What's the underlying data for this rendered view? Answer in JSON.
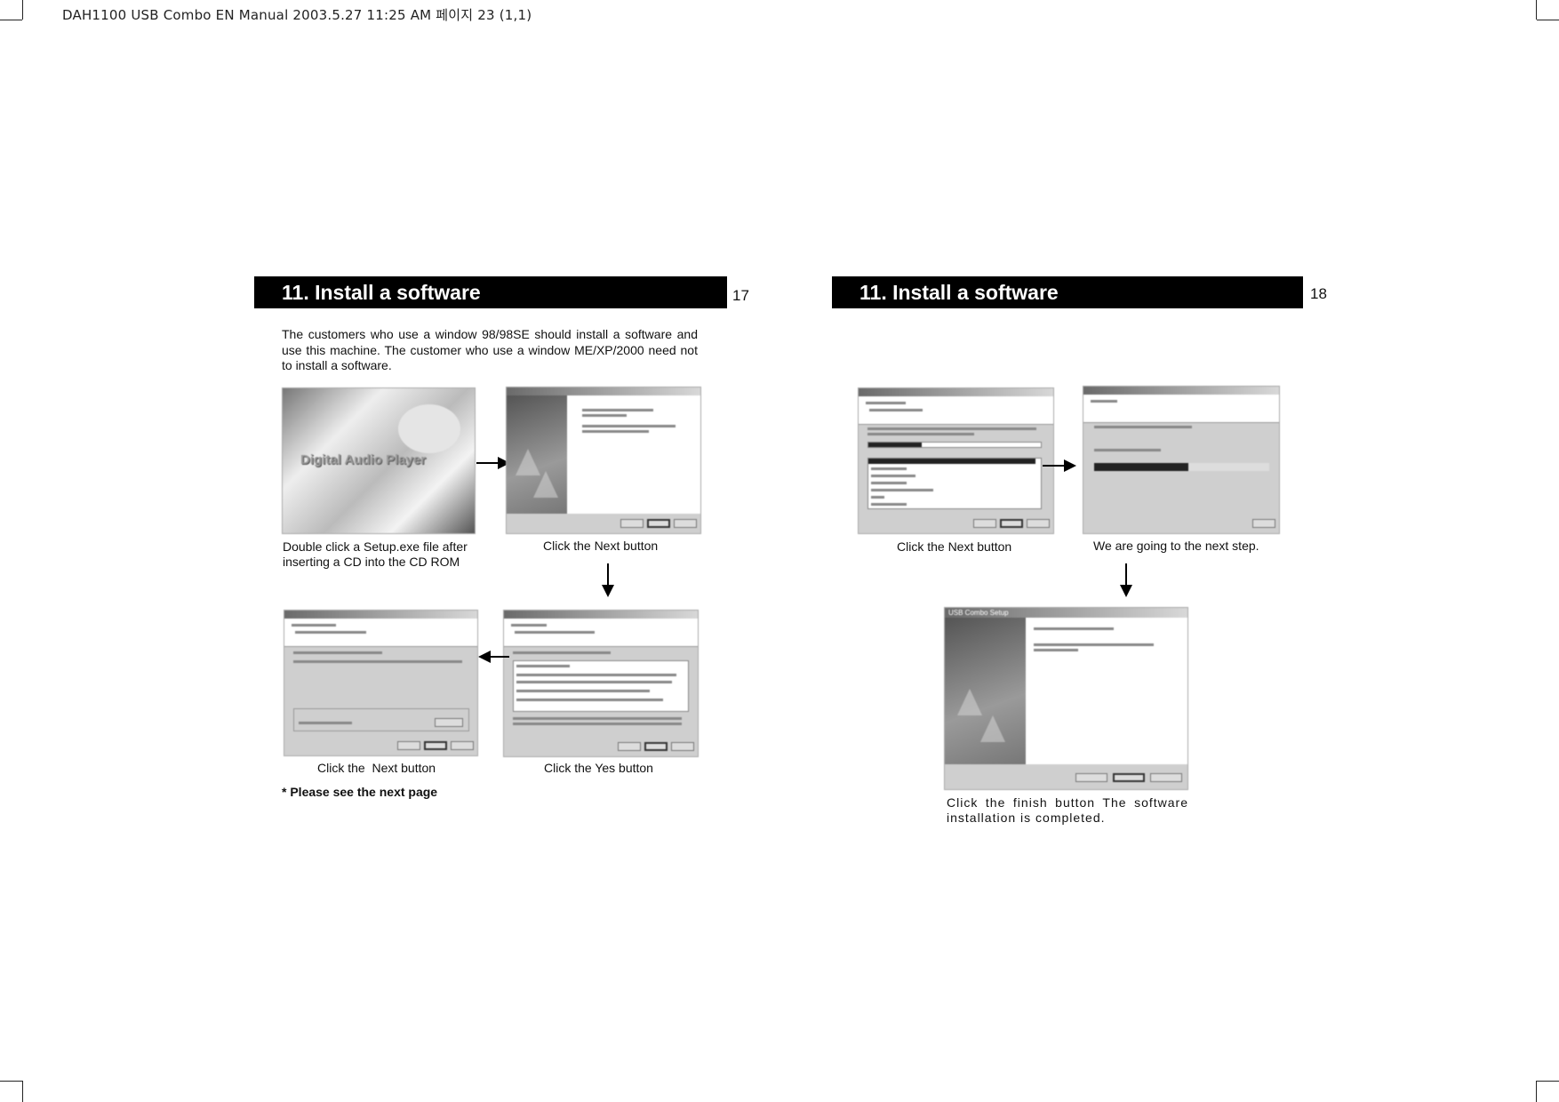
{
  "print_header": "DAH1100 USB Combo EN Manual  2003.5.27 11:25 AM  페이지 23 (1,1)",
  "left_page": {
    "title": "11. Install a software",
    "page_number": "17",
    "intro": "The customers who use a window 98/98SE should install a software and use this machine. The customer who use a window ME/XP/2000 need not to install a software.",
    "steps": [
      {
        "caption": "Double click a Setup.exe file after inserting a CD into the CD ROM",
        "image_text": "Digital Audio Player"
      },
      {
        "caption": "Click the Next button"
      },
      {
        "caption": "Click the Yes button"
      },
      {
        "caption": "Click the  Next button"
      }
    ],
    "note": "* Please see the next page"
  },
  "right_page": {
    "title": "11. Install a software",
    "page_number": "18",
    "steps": [
      {
        "caption": "Click the Next button"
      },
      {
        "caption": "We are going to the next step.",
        "progress_percent": 54
      },
      {
        "caption": "Click the finish button The software installation is completed.",
        "window_title": "USB Combo Setup"
      }
    ]
  },
  "colors": {
    "header_bar": "#000000",
    "header_text": "#ffffff",
    "dialog_gray": "#cfcfcf"
  }
}
